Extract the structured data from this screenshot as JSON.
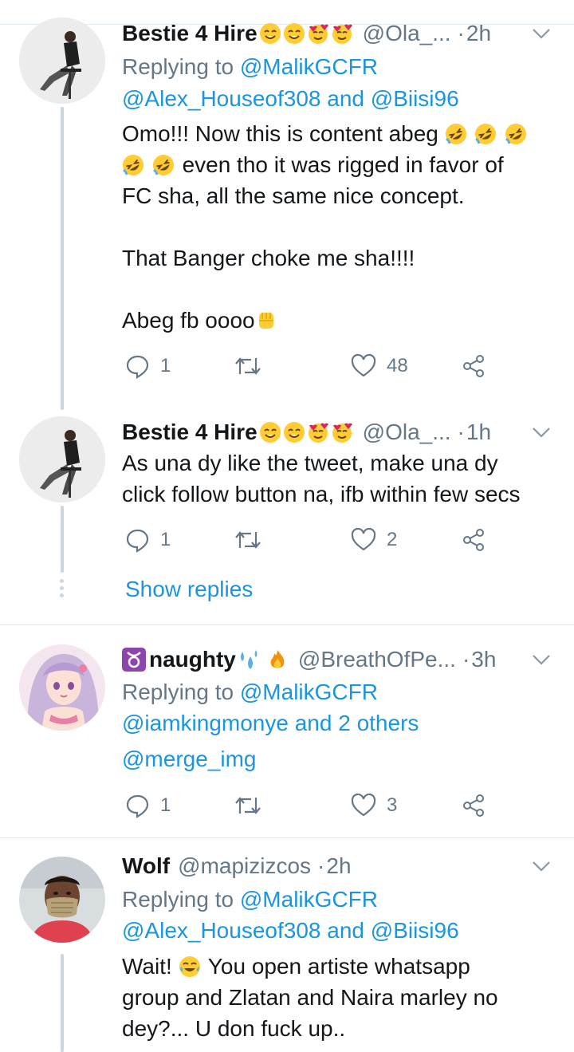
{
  "tweets": [
    {
      "name": "Bestie 4 Hire",
      "handle": "@Ola_...",
      "time": "2h",
      "replying_label": "Replying to",
      "replying_line1": "@MalikGCFR",
      "replying_line2_a": "@Alex_Houseof308",
      "replying_line2_and": " and ",
      "replying_line2_b": "@Biisi96",
      "body_line1": "Omo!!! Now this is content abeg",
      "body_line2": " even tho it was rigged in favor of",
      "body_line3": "FC sha, all the same nice concept.",
      "body_line4": "That Banger choke me sha!!!!",
      "body_line5": "Abeg fb oooo",
      "replies": "1",
      "retweets": "",
      "likes": "48"
    },
    {
      "name": "Bestie 4 Hire",
      "handle": "@Ola_...",
      "time": "1h",
      "body_line1": "As una dy like the tweet, make una dy",
      "body_line2": "click follow button na, ifb within few secs",
      "replies": "1",
      "retweets": "",
      "likes": "2",
      "show_replies": "Show replies"
    },
    {
      "name": "naughty",
      "handle": "@BreathOfPe...",
      "time": "3h",
      "replying_label": "Replying to",
      "replying_line1": "@MalikGCFR",
      "replying_line2_a": "@iamkingmonye",
      "replying_line2_rest": " and 2 others",
      "replying_line3": "@merge_img",
      "replies": "1",
      "retweets": "",
      "likes": "3"
    },
    {
      "name": "Wolf",
      "handle": "@mapizizcos",
      "time": "2h",
      "replying_label": "Replying to",
      "replying_line1": "@MalikGCFR",
      "replying_line2_a": "@Alex_Houseof308",
      "replying_line2_and": " and ",
      "replying_line2_b": "@Biisi96",
      "body_line1_a": "Wait! ",
      "body_line1_b": " You open artiste whatsapp",
      "body_line2": "group and Zlatan and Naira marley no",
      "body_line3": "dey?... U don fuck up.."
    }
  ],
  "colors": {
    "link": "#1b95e0",
    "secondary": "#657786",
    "text": "#14171a",
    "divider": "#e1e8ed",
    "thread_line": "#ccd6dd"
  }
}
